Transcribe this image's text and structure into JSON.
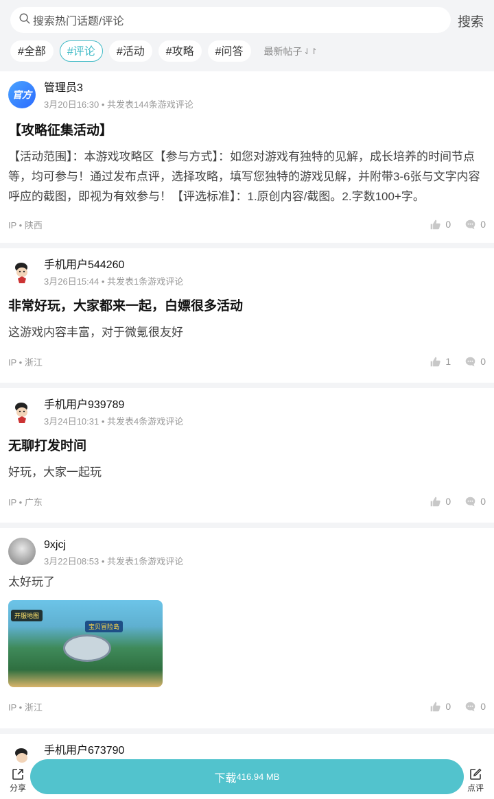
{
  "search": {
    "placeholder": "搜索热门话题/评论",
    "button": "搜索"
  },
  "tags": [
    {
      "label": "#全部",
      "active": false
    },
    {
      "label": "#评论",
      "active": true
    },
    {
      "label": "#活动",
      "active": false
    },
    {
      "label": "#攻略",
      "active": false
    },
    {
      "label": "#问答",
      "active": false
    }
  ],
  "sort": {
    "label": "最新帖子",
    "icon": "sort-arrows-icon"
  },
  "posts": [
    {
      "username": "管理员3",
      "avatar_text": "官方",
      "time": "3月20日16:30",
      "stats": "共发表144条游戏评论",
      "title": "【攻略征集活动】",
      "body": "【活动范围】：本游戏攻略区【参与方式】：如您对游戏有独特的见解，成长培养的时间节点等，均可参与！通过发布点评，选择攻略，填写您独特的游戏见解，并附带3-6张与文字内容呼应的截图，即视为有效参与！【评选标准】：1.原创内容/截图。2.字数100+字。",
      "ip": "IP • 陕西",
      "likes": "0",
      "comments": "0"
    },
    {
      "username": "手机用户544260",
      "time": "3月26日15:44",
      "stats": "共发表1条游戏评论",
      "title": "非常好玩，大家都来一起，白嫖很多活动",
      "body": "这游戏内容丰富，对于微氪很友好",
      "ip": "IP • 浙江",
      "likes": "1",
      "comments": "0"
    },
    {
      "username": "手机用户939789",
      "time": "3月24日10:31",
      "stats": "共发表4条游戏评论",
      "title": "无聊打发时间",
      "body": "好玩，大家一起玩",
      "ip": "IP • 广东",
      "likes": "0",
      "comments": "0"
    },
    {
      "username": "9xjcj",
      "time": "3月22日08:53",
      "stats": "共发表1条游戏评论",
      "body": "太好玩了",
      "image": {
        "label_top": "宝贝冒险岛",
        "label_corner": "开服地图"
      },
      "ip": "IP • 浙江",
      "likes": "0",
      "comments": "0"
    },
    {
      "username": "手机用户673790"
    }
  ],
  "bottom": {
    "share_label": "分享",
    "download_label": "下载",
    "download_size": "416.94 MB",
    "review_label": "点评"
  }
}
